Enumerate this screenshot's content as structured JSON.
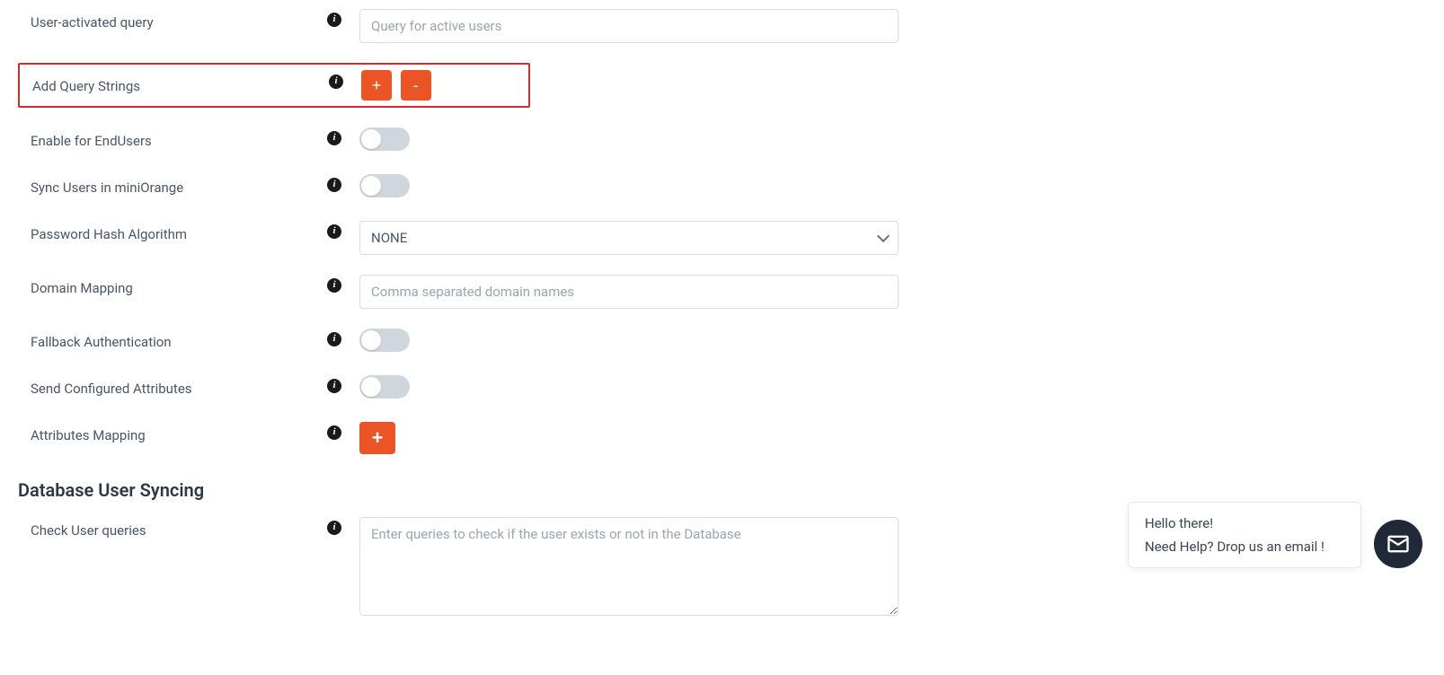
{
  "fields": {
    "user_activated_query": {
      "label": "User-activated query",
      "placeholder": "Query for active users",
      "value": ""
    },
    "add_query_strings": {
      "label": "Add Query Strings",
      "plus": "+",
      "minus": "-"
    },
    "enable_for_endusers": {
      "label": "Enable for EndUsers"
    },
    "sync_users": {
      "label": "Sync Users in miniOrange"
    },
    "password_hash": {
      "label": "Password Hash Algorithm",
      "selected": "NONE"
    },
    "domain_mapping": {
      "label": "Domain Mapping",
      "placeholder": "Comma separated domain names",
      "value": ""
    },
    "fallback_auth": {
      "label": "Fallback Authentication"
    },
    "send_configured_attrs": {
      "label": "Send Configured Attributes"
    },
    "attributes_mapping": {
      "label": "Attributes Mapping",
      "plus": "+"
    }
  },
  "section": {
    "db_user_syncing": "Database User Syncing",
    "check_user_queries": {
      "label": "Check User queries",
      "placeholder": "Enter queries to check if the user exists or not in the Database",
      "value": ""
    }
  },
  "chat": {
    "greeting": "Hello there!",
    "help": "Need Help? Drop us an email !"
  },
  "colors": {
    "accent": "#eb5424",
    "highlight_border": "#d12f2f",
    "text": "#4a5568"
  }
}
